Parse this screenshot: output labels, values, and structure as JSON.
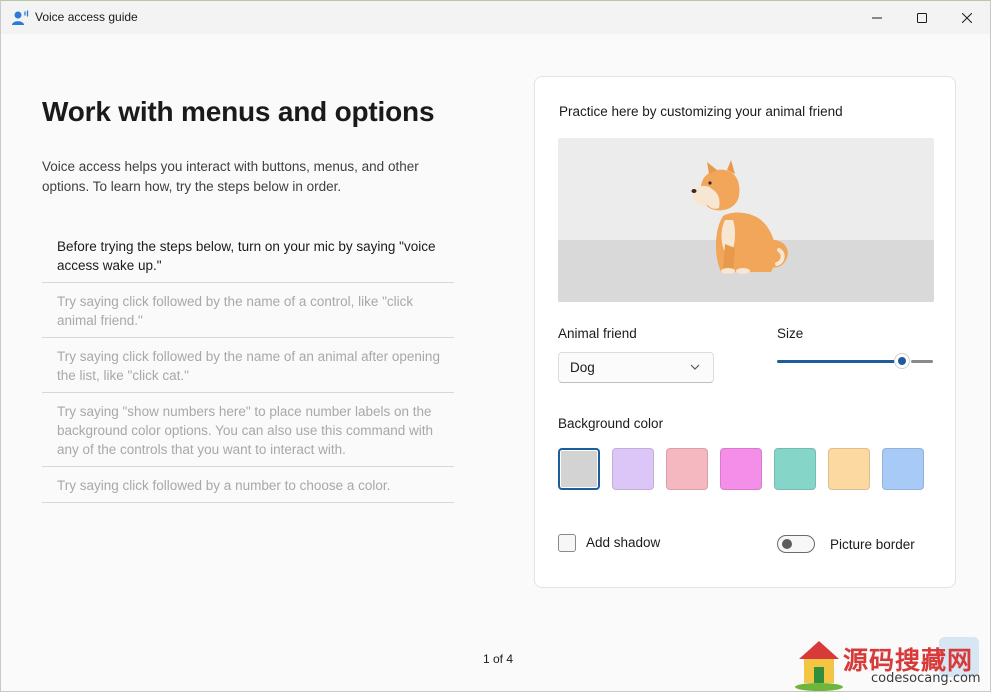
{
  "titlebar": {
    "title": "Voice access guide",
    "icons": [
      "voice-access-app-icon",
      "minimize-icon",
      "maximize-icon",
      "close-icon"
    ]
  },
  "main": {
    "title": "Work with menus and options",
    "intro": "Voice access helps you interact with buttons, menus, and other options. To learn how, try the steps below in order.",
    "steps": [
      {
        "text": "Before trying the steps below, turn on your mic by saying \"voice access wake up.\"",
        "active": true
      },
      {
        "text": "Try saying click followed by the name of a control, like \"click animal friend.\"",
        "active": false
      },
      {
        "text": "Try saying click followed by the name of an animal after opening the list, like \"click cat.\"",
        "active": false
      },
      {
        "text": "Try saying \"show numbers here\" to place number labels on the background color options. You can also use this command with any of the controls that you want to interact with.",
        "active": false
      },
      {
        "text": "Try saying click followed by a number to choose a color.",
        "active": false
      }
    ]
  },
  "practice": {
    "heading": "Practice here by customizing your animal friend",
    "animal_label": "Animal friend",
    "animal_value": "Dog",
    "size_label": "Size",
    "size_value": 0.82,
    "background_label": "Background color",
    "swatches": [
      "#d3d3d3",
      "#dcc6f7",
      "#f5b8c1",
      "#f58ee8",
      "#85d6c8",
      "#fcd9a0",
      "#a8caf7"
    ],
    "selected_swatch": 0,
    "shadow_label": "Add shadow",
    "shadow_checked": false,
    "border_label": "Picture border",
    "border_on": false
  },
  "footer": {
    "page_indicator": "1 of 4"
  },
  "watermark": {
    "text_cn": "源码搜藏网",
    "url": "codesocang.com"
  },
  "colors": {
    "accent": "#1e5d9c",
    "preview_bg": "#ececec",
    "preview_floor": "#d9d9d9"
  }
}
